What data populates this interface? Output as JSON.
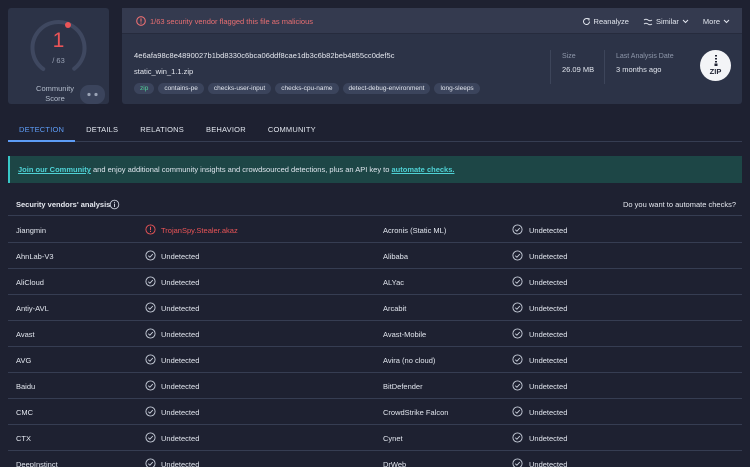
{
  "score": {
    "detections": "1",
    "total": "/ 63",
    "community_label_1": "Community",
    "community_label_2": "Score"
  },
  "alert": {
    "text": "1/63 security vendor flagged this file as malicious"
  },
  "actions": {
    "reanalyze": "Reanalyze",
    "similar": "Similar",
    "more": "More"
  },
  "file": {
    "hash": "4e6afa98c8e4890027b1bd8330c6bca06ddf8cae1db3c6b82beb4855cc0def5c",
    "name": "static_win_1.1.zip",
    "tags": [
      "zip",
      "contains-pe",
      "checks-user-input",
      "checks-cpu-name",
      "detect-debug-environment",
      "long-sleeps"
    ],
    "size_label": "Size",
    "size": "26.09 MB",
    "last_label": "Last Analysis Date",
    "last": "3 months ago",
    "type_icon": "ZIP"
  },
  "tabs": [
    "DETECTION",
    "DETAILS",
    "RELATIONS",
    "BEHAVIOR",
    "COMMUNITY"
  ],
  "banner": {
    "link1": "Join our Community",
    "middle": " and enjoy additional community insights and crowdsourced detections, plus an API key to ",
    "link2": "automate checks."
  },
  "vendors_section": {
    "title": "Security vendors' analysis",
    "right": "Do you want to automate checks?"
  },
  "colors": {
    "malicious": "#ea5457",
    "undetected": "#e3e7ef",
    "accent": "#5d9cf6",
    "banner": "#1d4646"
  },
  "rows": [
    {
      "v1": "Jiangmin",
      "r1": "TrojanSpy.Stealer.akaz",
      "s1": "bad",
      "v2": "Acronis (Static ML)",
      "r2": "Undetected",
      "s2": "ok"
    },
    {
      "v1": "AhnLab-V3",
      "r1": "Undetected",
      "s1": "ok",
      "v2": "Alibaba",
      "r2": "Undetected",
      "s2": "ok"
    },
    {
      "v1": "AliCloud",
      "r1": "Undetected",
      "s1": "ok",
      "v2": "ALYac",
      "r2": "Undetected",
      "s2": "ok"
    },
    {
      "v1": "Antiy-AVL",
      "r1": "Undetected",
      "s1": "ok",
      "v2": "Arcabit",
      "r2": "Undetected",
      "s2": "ok"
    },
    {
      "v1": "Avast",
      "r1": "Undetected",
      "s1": "ok",
      "v2": "Avast-Mobile",
      "r2": "Undetected",
      "s2": "ok"
    },
    {
      "v1": "AVG",
      "r1": "Undetected",
      "s1": "ok",
      "v2": "Avira (no cloud)",
      "r2": "Undetected",
      "s2": "ok"
    },
    {
      "v1": "Baidu",
      "r1": "Undetected",
      "s1": "ok",
      "v2": "BitDefender",
      "r2": "Undetected",
      "s2": "ok"
    },
    {
      "v1": "CMC",
      "r1": "Undetected",
      "s1": "ok",
      "v2": "CrowdStrike Falcon",
      "r2": "Undetected",
      "s2": "ok"
    },
    {
      "v1": "CTX",
      "r1": "Undetected",
      "s1": "ok",
      "v2": "Cynet",
      "r2": "Undetected",
      "s2": "ok"
    },
    {
      "v1": "DeepInstinct",
      "r1": "Undetected",
      "s1": "ok",
      "v2": "DrWeb",
      "r2": "Undetected",
      "s2": "ok"
    }
  ]
}
